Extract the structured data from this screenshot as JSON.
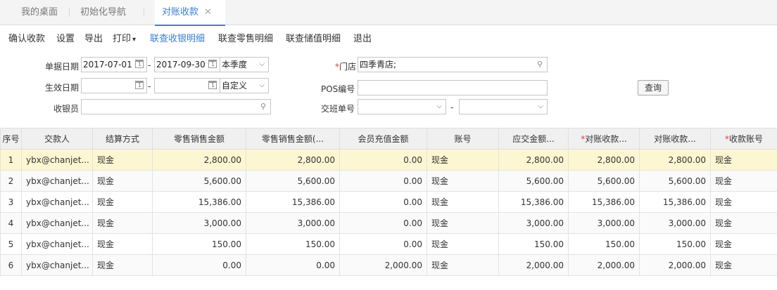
{
  "tabs": [
    {
      "label": "我的桌面"
    },
    {
      "label": "初始化导航"
    },
    {
      "label": "对账收款"
    }
  ],
  "toolbar": {
    "confirm": "确认收款",
    "settings": "设置",
    "export": "导出",
    "print": "打印",
    "cashier_detail": "联查收银明细",
    "retail_detail": "联查零售明细",
    "stored_value_detail": "联查储值明细",
    "exit": "退出"
  },
  "form": {
    "doc_date_label": "单据日期",
    "doc_date_from": "2017-07-01",
    "doc_date_to": "2017-09-30",
    "doc_date_range": "本季度",
    "effective_date_label": "生效日期",
    "effective_date_from": "",
    "effective_date_to": "",
    "effective_date_range": "自定义",
    "cashier_label": "收银员",
    "cashier_value": "",
    "store_label": "门店",
    "store_value": "四季青店;",
    "pos_label": "POS编号",
    "pos_value": "",
    "shift_label": "交班单号",
    "shift_from": "",
    "shift_to": "",
    "query_button": "查询"
  },
  "table": {
    "headers": [
      "序号",
      "交款人",
      "结算方式",
      "零售销售金额",
      "零售销售金额(...",
      "会员充值金额",
      "账号",
      "应交金额...",
      "对账收款...",
      "对账收款...",
      "收款账号"
    ],
    "required_headers": [
      false,
      false,
      false,
      false,
      false,
      false,
      false,
      false,
      true,
      false,
      true
    ],
    "rows": [
      [
        "1",
        "ybx@chanjet...",
        "现金",
        "2,800.00",
        "2,800.00",
        "0.00",
        "现金",
        "2,800.00",
        "2,800.00",
        "2,800.00",
        "现金"
      ],
      [
        "2",
        "ybx@chanjet...",
        "现金",
        "5,600.00",
        "5,600.00",
        "0.00",
        "现金",
        "5,600.00",
        "5,600.00",
        "5,600.00",
        "现金"
      ],
      [
        "3",
        "ybx@chanjet...",
        "现金",
        "15,386.00",
        "15,386.00",
        "0.00",
        "现金",
        "15,386.00",
        "15,386.00",
        "15,386.00",
        "现金"
      ],
      [
        "4",
        "ybx@chanjet...",
        "现金",
        "3,000.00",
        "3,000.00",
        "0.00",
        "现金",
        "3,000.00",
        "3,000.00",
        "3,000.00",
        "现金"
      ],
      [
        "5",
        "ybx@chanjet...",
        "现金",
        "150.00",
        "150.00",
        "0.00",
        "现金",
        "150.00",
        "150.00",
        "150.00",
        "现金"
      ],
      [
        "6",
        "ybx@chanjet...",
        "现金",
        "0.00",
        "0.00",
        "2,000.00",
        "现金",
        "2,000.00",
        "2,000.00",
        "2,000.00",
        "现金"
      ]
    ],
    "selected_row": 0
  },
  "colors": {
    "accent": "#3a7fd5",
    "required": "#e23b3b",
    "selected_row": "#fdf6d2"
  }
}
